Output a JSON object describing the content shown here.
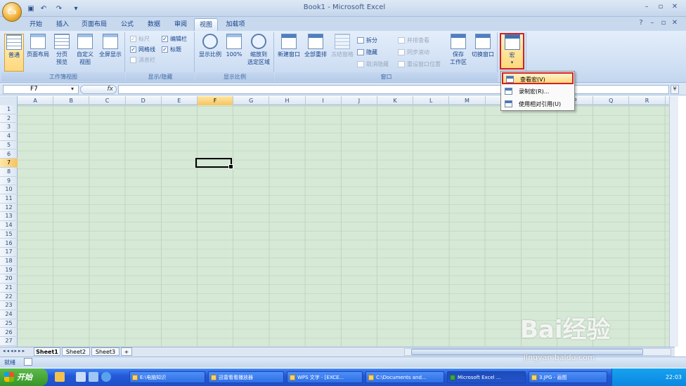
{
  "window": {
    "title": "Book1 - Microsoft Excel",
    "office_logo": "Ca"
  },
  "tabs": [
    "开始",
    "插入",
    "页面布局",
    "公式",
    "数据",
    "审阅",
    "视图",
    "加载项"
  ],
  "ribbon": {
    "workbook_views": {
      "label": "工作簿视图",
      "normal": "普通",
      "page_layout": "页面布局",
      "page_break": "分页\n预览",
      "custom": "自定义\n视图",
      "fullscreen": "全屏显示"
    },
    "show_hide": {
      "label": "显示/隐藏",
      "ruler": "标尺",
      "formula_bar": "编辑栏",
      "gridlines": "网格线",
      "headings": "标题",
      "message_bar": "消息栏"
    },
    "zoom": {
      "label": "显示比例",
      "zoom": "显示比例",
      "zoom100": "100%",
      "zoom_selection": "缩放到\n选定区域"
    },
    "window": {
      "label": "窗口",
      "new_window": "新建窗口",
      "arrange_all": "全部重排",
      "freeze": "冻结窗格",
      "split": "拆分",
      "hide": "隐藏",
      "unhide": "取消隐藏",
      "side_by_side": "并排查看",
      "sync_scroll": "同步滚动",
      "reset_position": "重设窗口位置",
      "save_workspace": "保存\n工作区",
      "switch_windows": "切换窗口"
    },
    "macros": {
      "label": "宏"
    }
  },
  "macro_menu": [
    "查看宏(V)",
    "录制宏(R)...",
    "使用相对引用(U)"
  ],
  "formula_bar": {
    "name_box": "F7",
    "fx": "fx",
    "value": ""
  },
  "columns": [
    "A",
    "B",
    "C",
    "D",
    "E",
    "F",
    "G",
    "H",
    "I",
    "J",
    "K",
    "L",
    "M",
    "N",
    "O",
    "P",
    "Q",
    "R"
  ],
  "rows": [
    "1",
    "2",
    "3",
    "4",
    "5",
    "6",
    "7",
    "8",
    "9",
    "10",
    "11",
    "12",
    "13",
    "14",
    "15",
    "16",
    "17",
    "18",
    "19",
    "20",
    "21",
    "22",
    "23",
    "24",
    "25",
    "26",
    "27"
  ],
  "selected": {
    "column": "F",
    "row": "7"
  },
  "sheets": [
    "Sheet1",
    "Sheet2",
    "Sheet3"
  ],
  "status": {
    "ready": "就绪"
  },
  "taskbar": {
    "start": "开始",
    "items": [
      "E:\\电脑知识",
      "迅雷看看播放器",
      "WPS 文字 - [EXCE...",
      "C:\\Documents and...",
      "Microsoft Excel ...",
      "3.JPG - 画图"
    ],
    "clock": "22:03"
  },
  "watermark": {
    "brand": "Bai经验",
    "url": "jingyan.baidu.com"
  }
}
